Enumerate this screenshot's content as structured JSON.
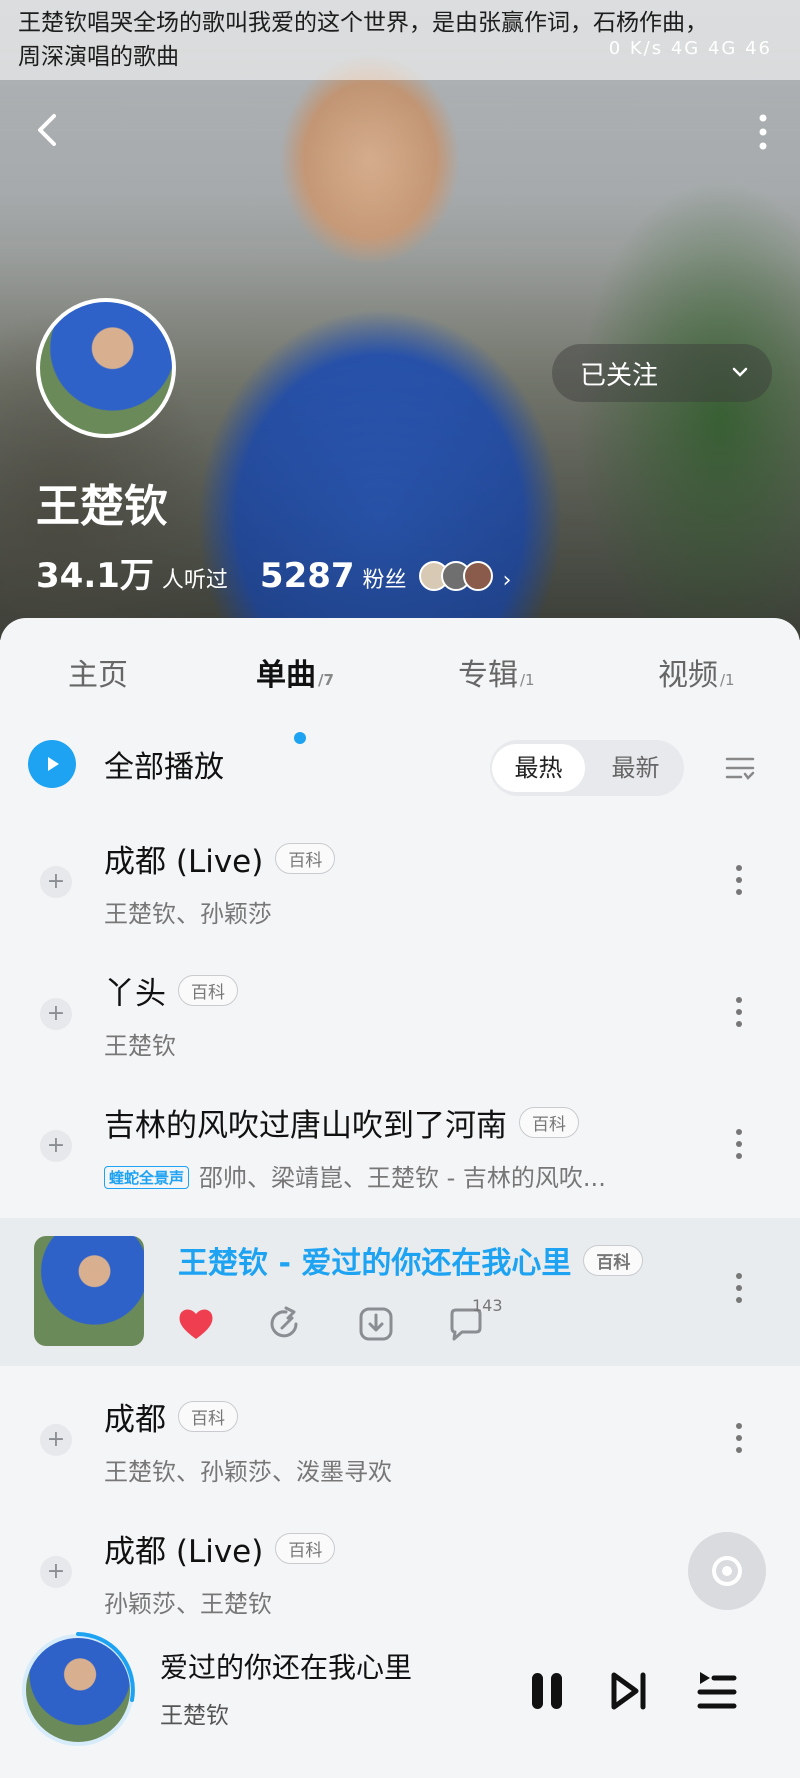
{
  "caption": {
    "line1": "王楚钦唱哭全场的歌叫我爱的这个世界，是由张赢作词，石杨作曲，",
    "line2": "周深演唱的歌曲"
  },
  "status": {
    "network": "0 K/s  4G  4G  46"
  },
  "artist": {
    "name": "王楚钦",
    "listeners": "34.1万",
    "listeners_label": "人听过",
    "fans": "5287",
    "fans_label": "粉丝",
    "follow_label": "已关注"
  },
  "tabs": [
    {
      "label": "主页",
      "count": ""
    },
    {
      "label": "单曲",
      "count": "/7"
    },
    {
      "label": "专辑",
      "count": "/1"
    },
    {
      "label": "视频",
      "count": "/1"
    }
  ],
  "toolbar": {
    "play_all": "全部播放",
    "sort_hot": "最热",
    "sort_new": "最新"
  },
  "songs": [
    {
      "title": "成都 (Live)",
      "badge": "百科",
      "artists": "王楚钦、孙颖莎",
      "tag": ""
    },
    {
      "title": "丫头",
      "badge": "百科",
      "artists": "王楚钦",
      "tag": ""
    },
    {
      "title": "吉林的风吹过唐山吹到了河南",
      "badge": "百科",
      "artists": "邵帅、梁靖崑、王楚钦 - 吉林的风吹...",
      "tag": "蝰蛇全景声"
    },
    {
      "title": "成都",
      "badge": "百科",
      "artists": "王楚钦、孙颖莎、泼墨寻欢",
      "tag": ""
    },
    {
      "title": "成都 (Live)",
      "badge": "百科",
      "artists": "孙颖莎、王楚钦",
      "tag": ""
    }
  ],
  "now_playing_row": {
    "title": "王楚钦 - 爱过的你还在我心里",
    "badge": "百科",
    "comment_count": "143",
    "colors": {
      "accent": "#1ea3f2",
      "like": "#ef3e4f"
    }
  },
  "mini_player": {
    "title": "爱过的你还在我心里",
    "artist": "王楚钦"
  }
}
